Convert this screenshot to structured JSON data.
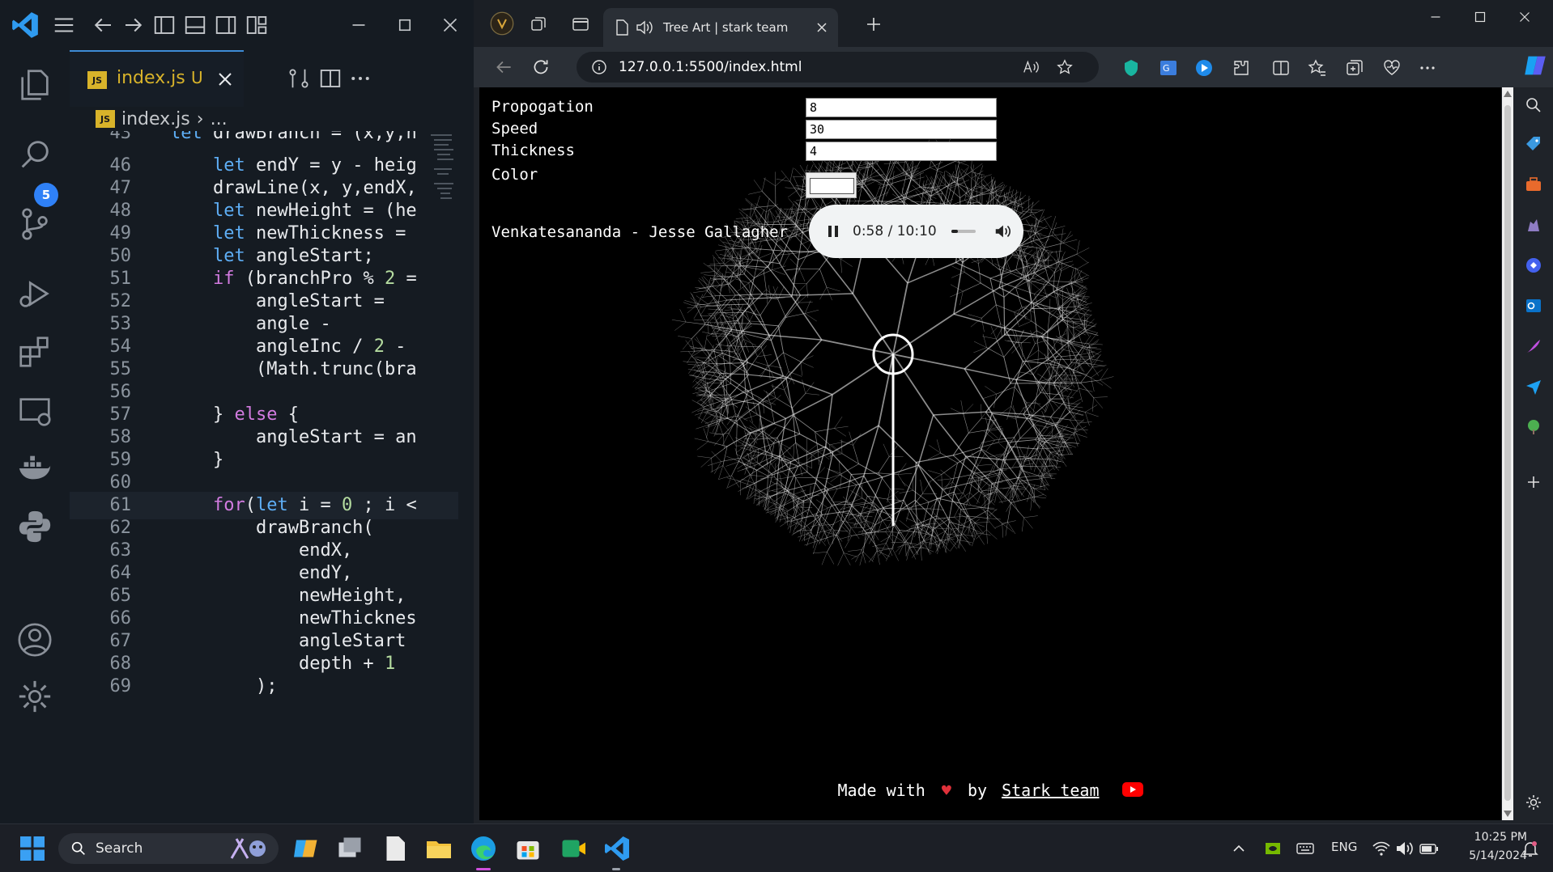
{
  "vscode": {
    "tab": {
      "file": "index.js",
      "status": "U"
    },
    "breadcrumb": {
      "file": "index.js",
      "rest": "..."
    },
    "scm_badge": "5",
    "lines": [
      {
        "n": "43",
        "text": "let drawBranch = (x,y,h"
      },
      {
        "n": "46",
        "text": "    let endY = y - heig"
      },
      {
        "n": "47",
        "text": "    drawLine(x, y,endX,"
      },
      {
        "n": "48",
        "text": "    let newHeight = (he"
      },
      {
        "n": "49",
        "text": "    let newThickness ="
      },
      {
        "n": "50",
        "text": "    let angleStart;"
      },
      {
        "n": "51",
        "text": "    if (branchPro % 2 ="
      },
      {
        "n": "52",
        "text": "        angleStart ="
      },
      {
        "n": "53",
        "text": "        angle -"
      },
      {
        "n": "54",
        "text": "        angleInc / 2 -"
      },
      {
        "n": "55",
        "text": "        (Math.trunc(bra"
      },
      {
        "n": "56",
        "text": ""
      },
      {
        "n": "57",
        "text": "    } else {"
      },
      {
        "n": "58",
        "text": "        angleStart = an"
      },
      {
        "n": "59",
        "text": "    }"
      },
      {
        "n": "60",
        "text": ""
      },
      {
        "n": "61",
        "text": "    for(let i = 0 ; i <"
      },
      {
        "n": "62",
        "text": "        drawBranch("
      },
      {
        "n": "63",
        "text": "            endX,"
      },
      {
        "n": "64",
        "text": "            endY,"
      },
      {
        "n": "65",
        "text": "            newHeight,"
      },
      {
        "n": "66",
        "text": "            newThicknes"
      },
      {
        "n": "67",
        "text": "            angleStart"
      },
      {
        "n": "68",
        "text": "            depth + 1"
      },
      {
        "n": "69",
        "text": "        );"
      }
    ]
  },
  "edge": {
    "tab_title": "Tree Art | stark team",
    "url": "127.0.0.1:5500/index.html",
    "page": {
      "controls": [
        {
          "label": "Propogation",
          "value": "8"
        },
        {
          "label": "Speed",
          "value": "30"
        },
        {
          "label": "Thickness",
          "value": "4"
        }
      ],
      "color_label": "Color",
      "song": "Venkatesananda - Jesse Gallagher",
      "audio_time": "0:58 / 10:10",
      "footer": {
        "made_with": "Made with",
        "by": "by",
        "team": "Stark team"
      }
    }
  },
  "taskbar": {
    "search_label": "Search",
    "lang": "ENG",
    "time": "10:25 PM",
    "date": "5/14/2024"
  },
  "colors": {
    "accent_blue": "#3d8bd6",
    "heart": "#e0313a",
    "youtube": "#ff0000"
  }
}
